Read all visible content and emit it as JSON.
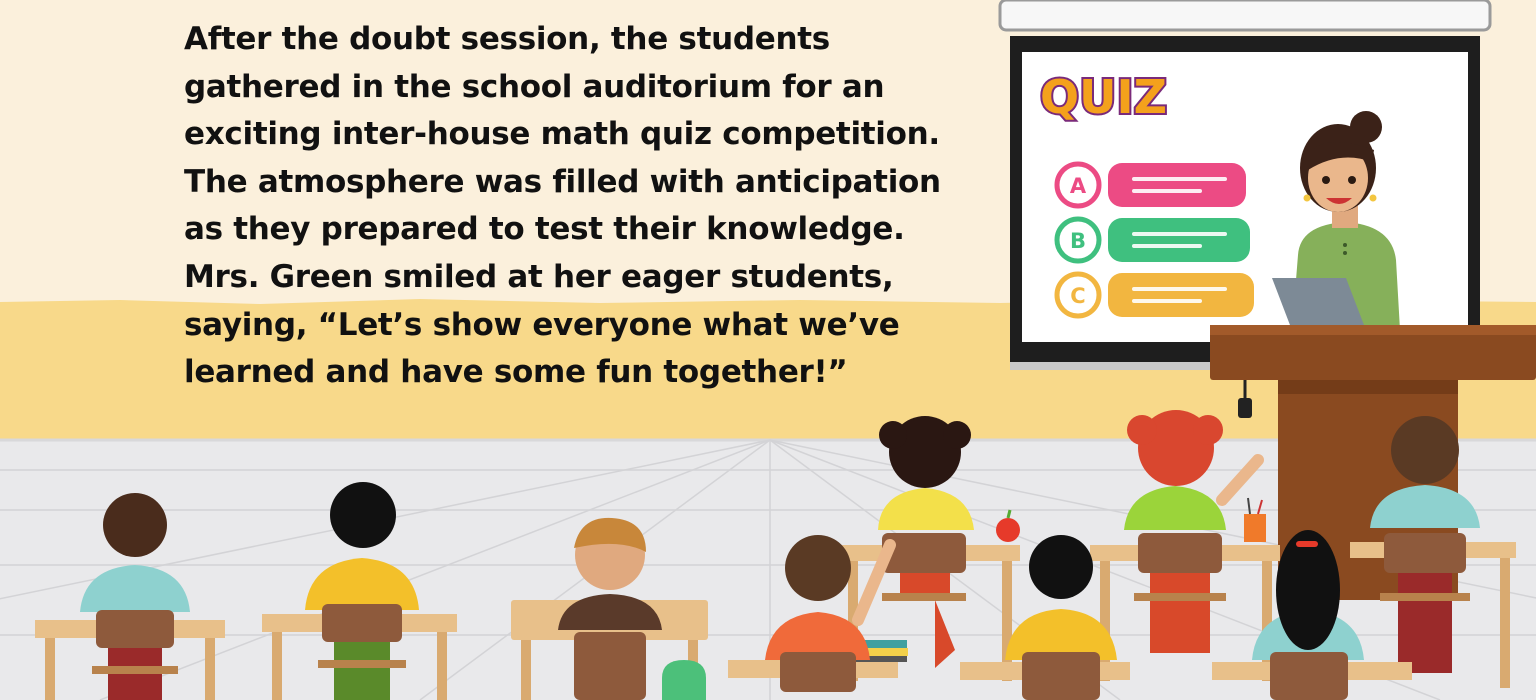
{
  "story": {
    "lines": [
      "After the doubt session, the students",
      "gathered in the school auditorium for an",
      "exciting inter-house math quiz competition.",
      "The atmosphere was filled with anticipation",
      "as they prepared to test their knowledge.",
      "Mrs. Green smiled at her eager students,",
      "saying, “Let’s show everyone what we’ve",
      "learned and have some fun together!”"
    ]
  },
  "screen": {
    "title": "QUIZ",
    "options": [
      {
        "letter": "A",
        "color": "#ec4b84"
      },
      {
        "letter": "B",
        "color": "#3fc07f"
      },
      {
        "letter": "C",
        "color": "#f2b640"
      }
    ]
  },
  "colors": {
    "wall": "#fbf0dc",
    "wall_band": "#f8d98a",
    "floor": "#e8e8ea",
    "desk": "#e8c08a",
    "chair": "#8e5a3c",
    "podium": "#8a4a20"
  }
}
